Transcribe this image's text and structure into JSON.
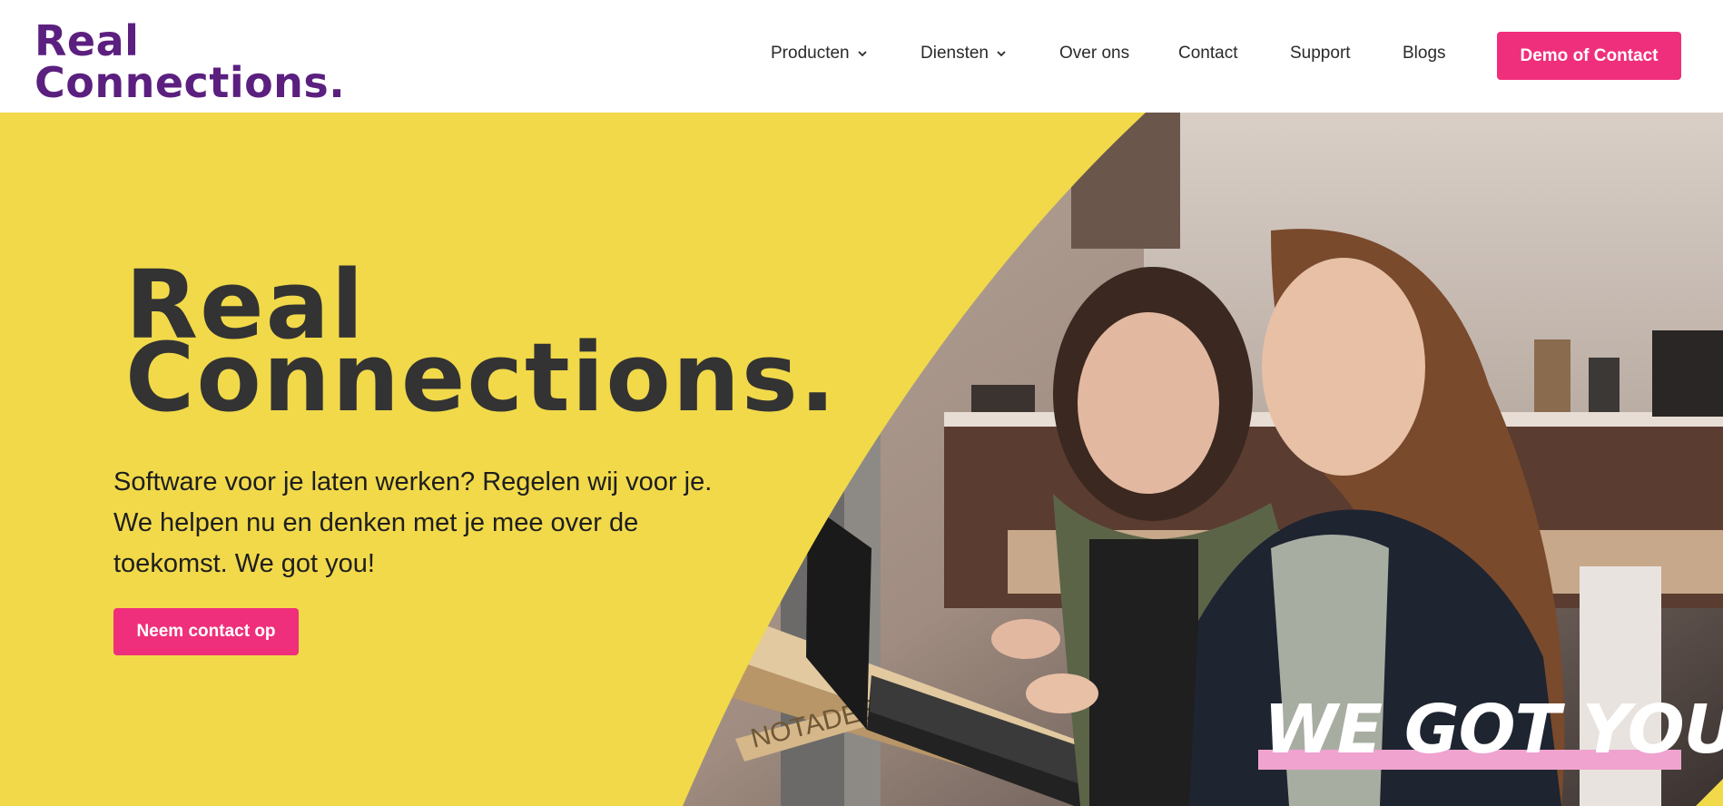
{
  "header": {
    "logo": {
      "line1": "Real",
      "line2": "Connections."
    },
    "nav": {
      "producten": "Producten",
      "diensten": "Diensten",
      "over_ons": "Over ons",
      "contact": "Contact",
      "support": "Support",
      "blogs": "Blogs"
    },
    "cta_label": "Demo of Contact"
  },
  "hero": {
    "title_line1": "Real",
    "title_line2": "Connections.",
    "subtitle_line1": "Software voor je laten werken? Regelen wij voor je.",
    "subtitle_line2": "We helpen nu en denken met je mee over de",
    "subtitle_line3": "toekomst. We got you!",
    "button_label": "Neem contact op",
    "slogan": "WE GOT YOU",
    "desk_text": "NOTADESK"
  },
  "colors": {
    "brand_purple": "#5b1f7f",
    "accent_pink": "#ef2f7b",
    "hero_yellow": "#f1d94a",
    "slogan_underline": "#f0a3cf"
  },
  "icons": {
    "dropdown": "chevron-down-icon"
  }
}
